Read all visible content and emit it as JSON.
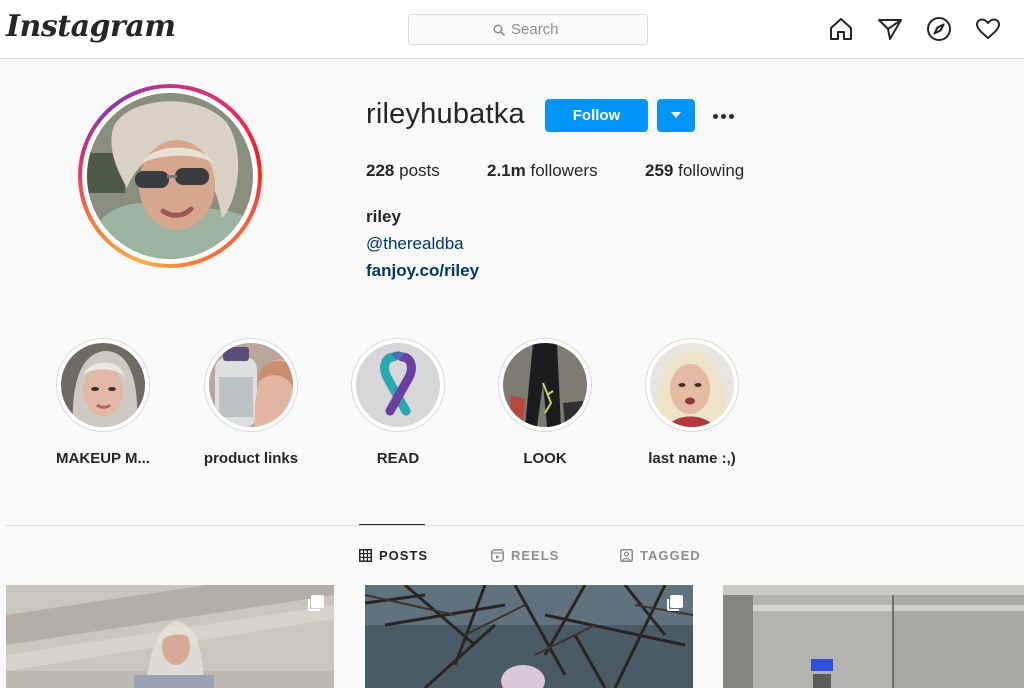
{
  "app": {
    "logo_text": "Instagram"
  },
  "topbar": {
    "search": {
      "placeholder": "Search",
      "icon": "search-icon"
    },
    "nav_icons": [
      "home-icon",
      "direct-message-icon",
      "explore-icon",
      "activity-heart-icon"
    ]
  },
  "profile": {
    "username": "rileyhubatka",
    "follow_label": "Follow",
    "stats": {
      "posts_count": "228",
      "posts_label": "posts",
      "followers_count": "2.1m",
      "followers_label": "followers",
      "following_count": "259",
      "following_label": "following"
    },
    "bio": {
      "name": "riley",
      "mention": "@therealdba",
      "link": "fanjoy.co/riley"
    }
  },
  "highlights": [
    {
      "label": "MAKEUP M..."
    },
    {
      "label": "product links"
    },
    {
      "label": "READ"
    },
    {
      "label": "LOOK"
    },
    {
      "label": "last name :,)"
    }
  ],
  "tabs": [
    {
      "label": "POSTS",
      "icon": "grid-icon",
      "active": true
    },
    {
      "label": "REELS",
      "icon": "reels-icon",
      "active": false
    },
    {
      "label": "TAGGED",
      "icon": "tagged-icon",
      "active": false
    }
  ],
  "colors": {
    "accent_blue": "#0095f6",
    "link_blue": "#00376b",
    "text": "#262626",
    "muted": "#8e8e8e",
    "border": "#dbdbdb",
    "background": "#fafafa"
  }
}
